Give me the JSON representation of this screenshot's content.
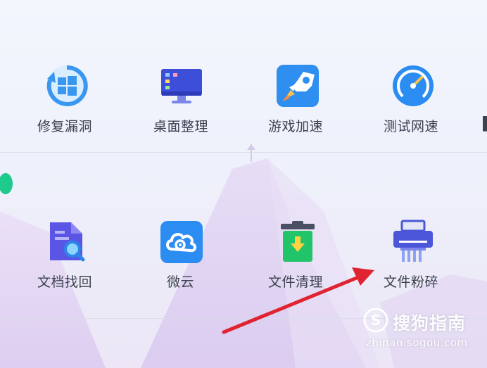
{
  "row1": {
    "items": [
      {
        "label": "修复漏洞",
        "icon": "windows-repair-icon"
      },
      {
        "label": "桌面整理",
        "icon": "desktop-monitor-icon"
      },
      {
        "label": "游戏加速",
        "icon": "game-rocket-icon"
      },
      {
        "label": "测试网速",
        "icon": "speedometer-icon"
      }
    ]
  },
  "row2": {
    "items": [
      {
        "label": "文档找回",
        "icon": "document-search-icon"
      },
      {
        "label": "微云",
        "icon": "cloud-icon"
      },
      {
        "label": "文件清理",
        "icon": "trash-bin-icon"
      },
      {
        "label": "文件粉碎",
        "icon": "shredder-icon"
      }
    ]
  },
  "watermark": {
    "brand": "搜狗指南",
    "url": "zhinan.sogou.com"
  },
  "colors": {
    "accent_blue": "#2b8cf2",
    "green_dot": "#1ecb8c",
    "red_arrow": "#e02330",
    "trash_green": "#22c46a"
  }
}
